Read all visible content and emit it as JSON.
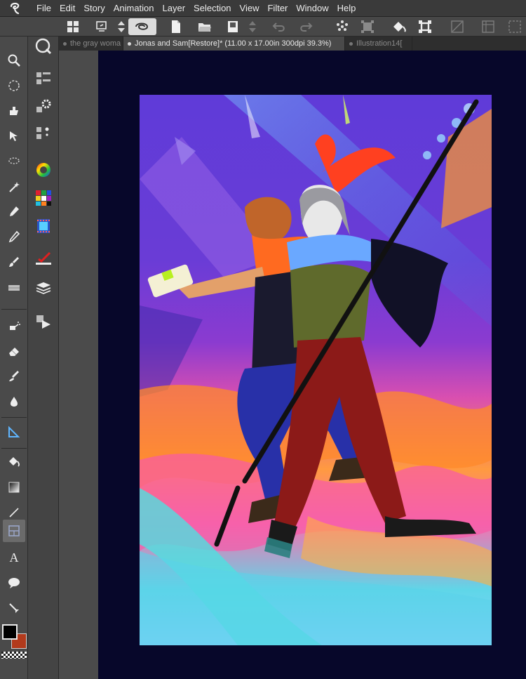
{
  "menubar": {
    "items": [
      "File",
      "Edit",
      "Story",
      "Animation",
      "Layer",
      "Selection",
      "View",
      "Filter",
      "Window",
      "Help"
    ]
  },
  "tabs": [
    {
      "label": "the gray woma",
      "active": false
    },
    {
      "label": "Jonas and Sam[Restore]* (11.00 x 17.00in 300dpi 39.3%)",
      "active": true
    },
    {
      "label": "Illustration14[",
      "active": false
    }
  ],
  "colors": {
    "main_color": "#000000",
    "sub_color": "#b23a1c",
    "workspace_bg": "#07072a"
  },
  "toolbar": {
    "left_collapse_arrows": "«  ≡  »",
    "icons": [
      "canvas-grid-icon",
      "undo-history-icon",
      "spin-stepper-icon",
      "spiral-snap-icon",
      "new-file-icon",
      "open-folder-icon",
      "save-icon",
      "stepper-icon",
      "undo-icon",
      "redo-icon",
      "scatter-icon",
      "transform-icon",
      "fill-icon",
      "crop-icon",
      "ruler-off-icon",
      "grid-off-icon"
    ]
  },
  "tools": [
    "zoom-tool",
    "move-tool",
    "lasso-move-tool",
    "object-select-tool",
    "lasso-tool",
    "magic-wand-tool",
    "pen-tool",
    "pencil-tool",
    "brush-tool",
    "palette-tool",
    "airbrush-tool",
    "eraser-tool",
    "blend-tool",
    "drop-tool",
    "ruler-tool",
    "fill-tool",
    "gradient-tool",
    "line-tool",
    "frame-tool",
    "text-tool",
    "balloon-tool",
    "correct-line-tool"
  ]
}
